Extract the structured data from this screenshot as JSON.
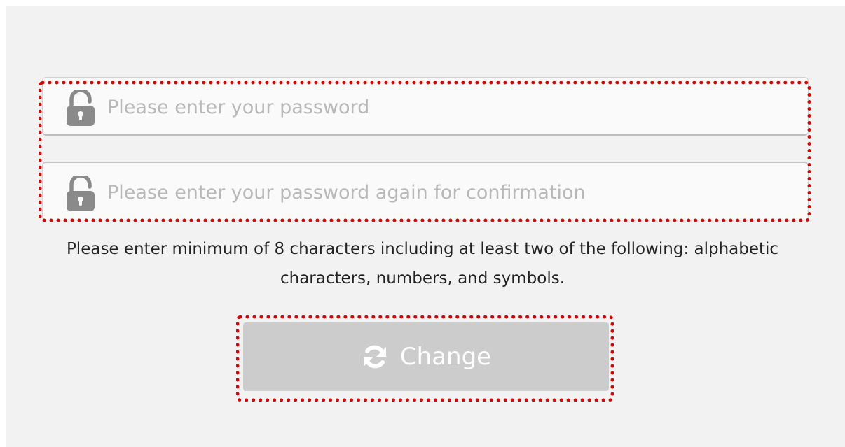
{
  "form": {
    "password": {
      "icon": "unlock-icon",
      "placeholder": "Please enter your password",
      "value": ""
    },
    "confirm_password": {
      "icon": "unlock-icon",
      "placeholder": "Please enter your password again for confirmation",
      "value": ""
    },
    "hint": "Please enter minimum of 8 characters including at least two of the following: alphabetic characters, numbers, and symbols.",
    "change_button": {
      "icon": "refresh-icon",
      "label": "Change",
      "enabled": false
    }
  },
  "colors": {
    "panel_background": "#f2f2f2",
    "field_background": "#fafafa",
    "placeholder_text": "#b8b8b8",
    "icon_gray": "#8a8a8a",
    "button_disabled_background": "#cccccc",
    "button_text": "#ffffff",
    "highlight_outline": "#e00000"
  }
}
